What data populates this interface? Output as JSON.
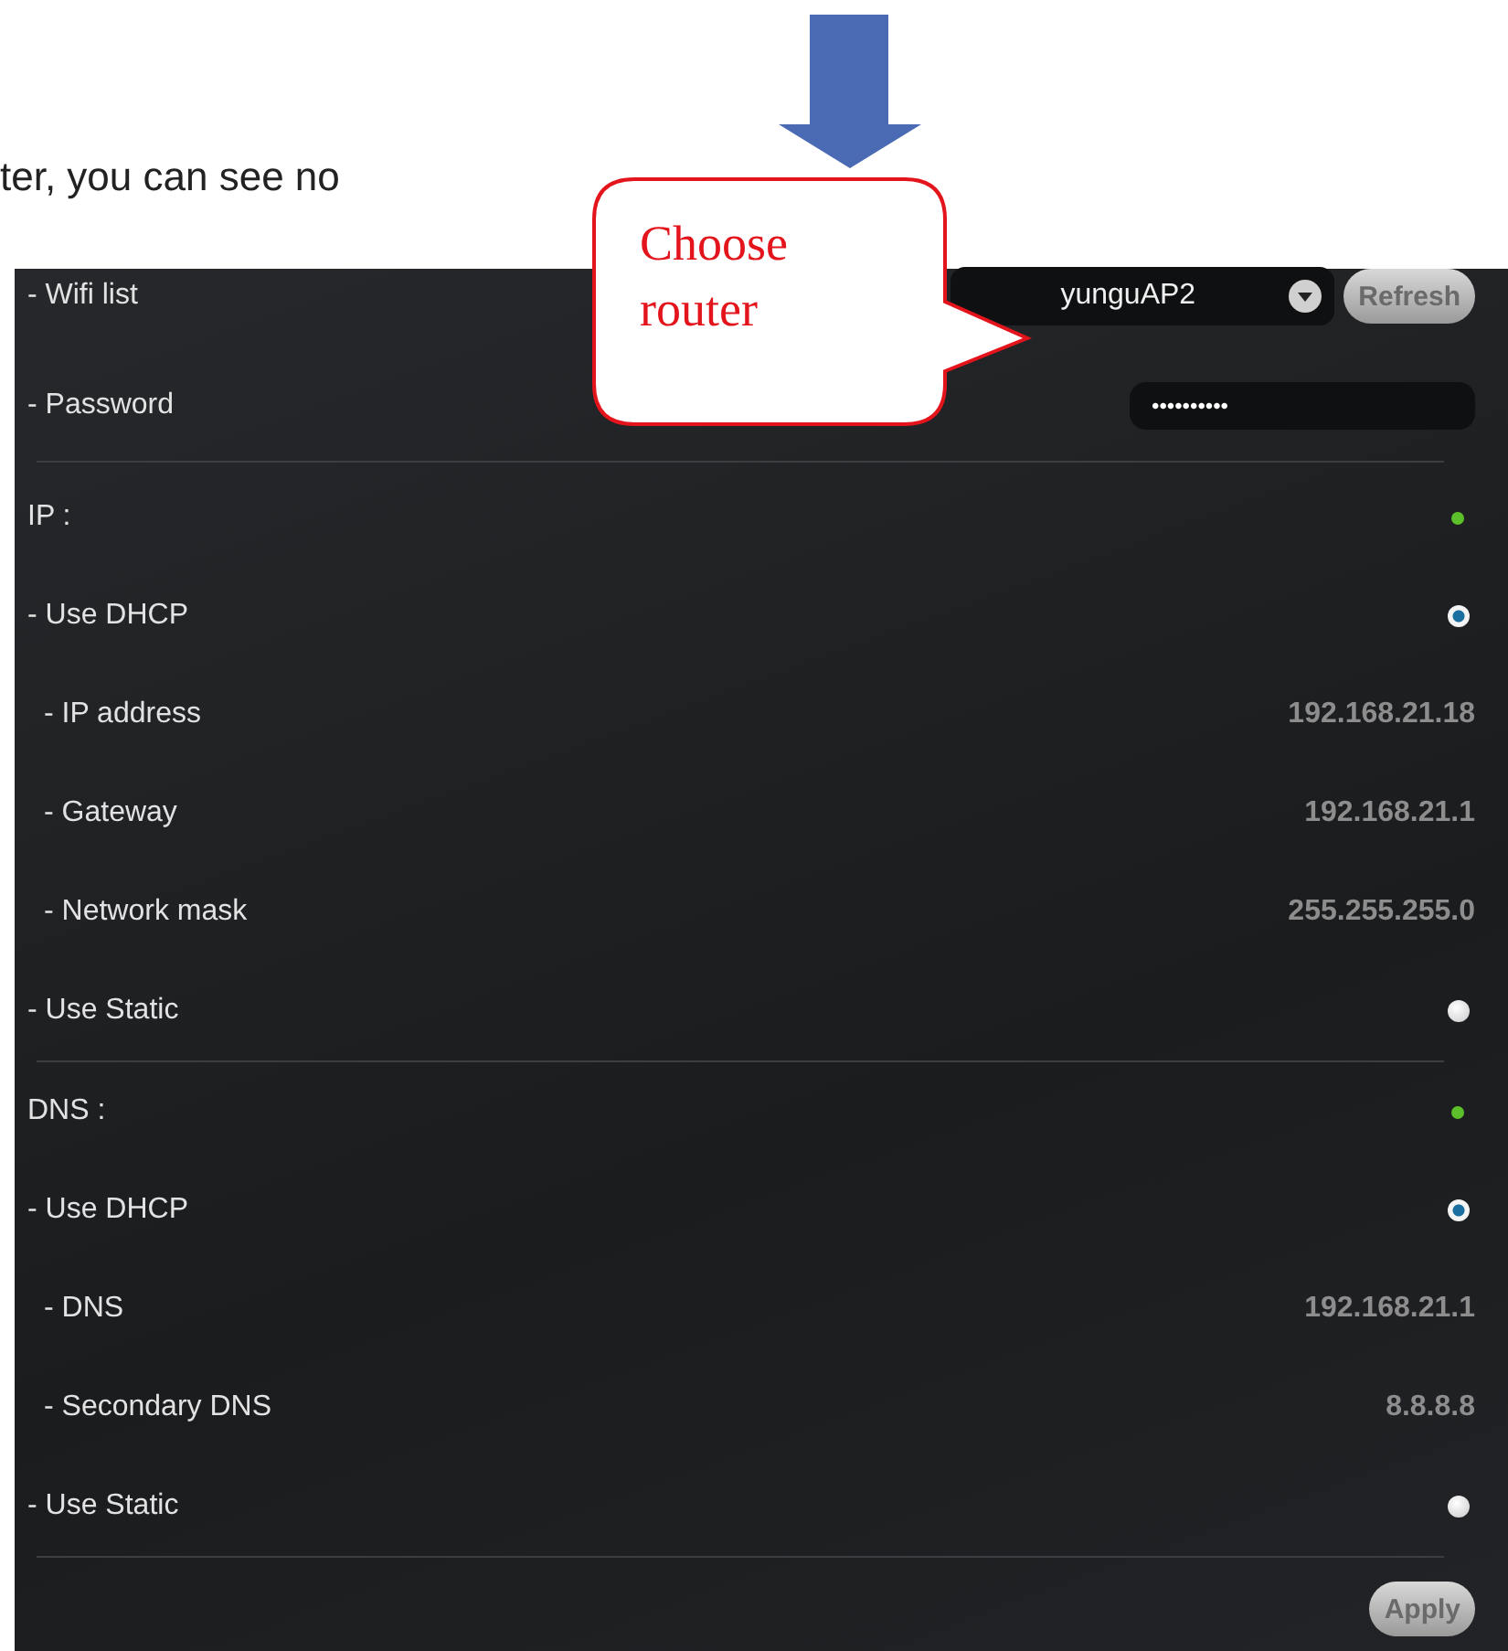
{
  "intro_text": "ter, you can see no",
  "callout": {
    "lines": [
      "Choose",
      "router"
    ]
  },
  "wifi": {
    "label": "- Wifi list",
    "network": "yunguAP2",
    "refresh": "Refresh"
  },
  "password": {
    "label": "- Password",
    "value": "••••••••••"
  },
  "sections": [
    {
      "title": "IP :",
      "active": true,
      "rows": [
        {
          "kind": "radio",
          "label": "- Use DHCP",
          "selected": true
        },
        {
          "kind": "value",
          "label": "- IP address",
          "value": "192.168.21.18"
        },
        {
          "kind": "value",
          "label": "- Gateway",
          "value": "192.168.21.1"
        },
        {
          "kind": "value",
          "label": "- Network mask",
          "value": "255.255.255.0"
        },
        {
          "kind": "radio",
          "label": "- Use Static",
          "selected": false
        }
      ]
    },
    {
      "title": "DNS :",
      "active": true,
      "rows": [
        {
          "kind": "radio",
          "label": "- Use DHCP",
          "selected": true
        },
        {
          "kind": "value",
          "label": "- DNS",
          "value": "192.168.21.1"
        },
        {
          "kind": "value",
          "label": "- Secondary DNS",
          "value": "8.8.8.8"
        },
        {
          "kind": "radio",
          "label": "- Use Static",
          "selected": false
        }
      ]
    }
  ],
  "apply": "Apply"
}
